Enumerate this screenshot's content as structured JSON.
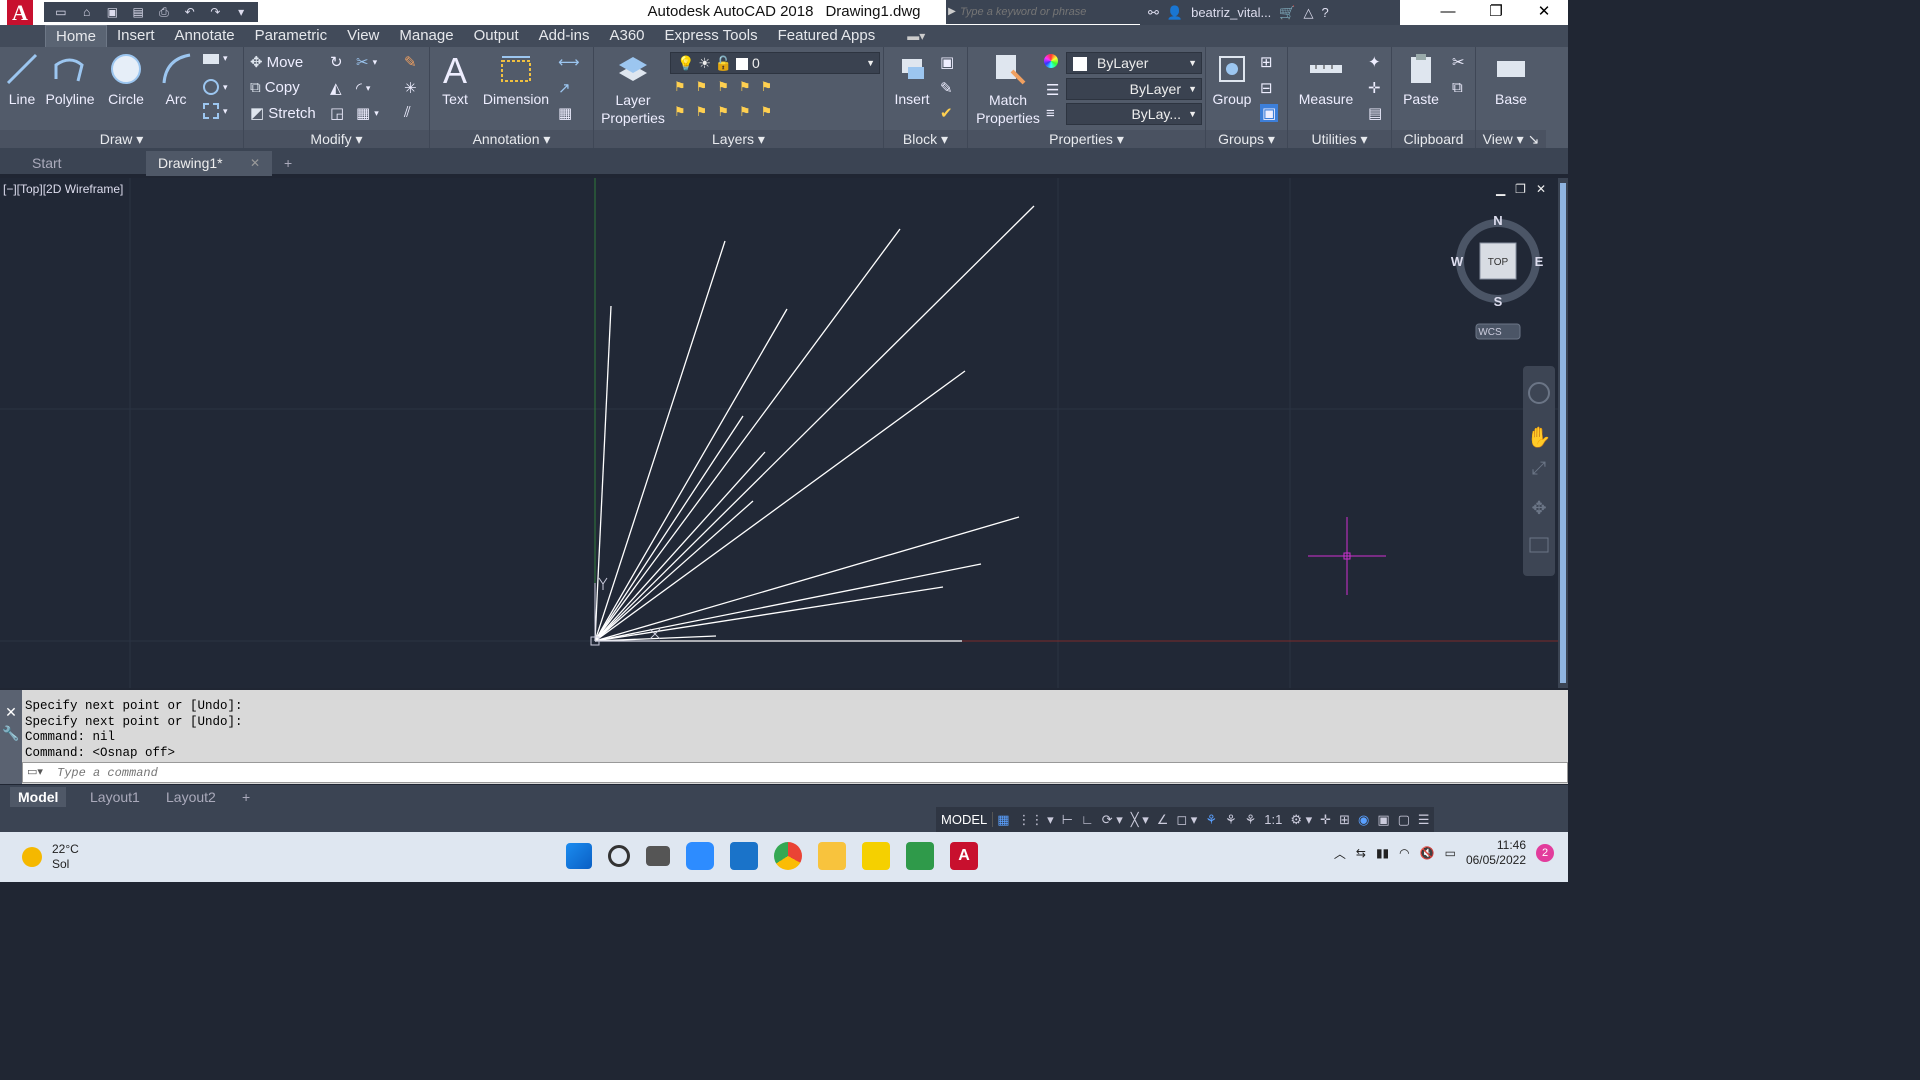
{
  "window": {
    "app": "Autodesk AutoCAD 2018",
    "doc": "Drawing1.dwg",
    "search_placeholder": "Type a keyword or phrase",
    "user": "beatriz_vital..."
  },
  "tabs": [
    "Home",
    "Insert",
    "Annotate",
    "Parametric",
    "View",
    "Manage",
    "Output",
    "Add-ins",
    "A360",
    "Express Tools",
    "Featured Apps"
  ],
  "ribbon": {
    "draw": {
      "title": "Draw",
      "line": "Line",
      "polyline": "Polyline",
      "circle": "Circle",
      "arc": "Arc"
    },
    "modify": {
      "title": "Modify",
      "move": "Move",
      "copy": "Copy",
      "stretch": "Stretch"
    },
    "annotation": {
      "title": "Annotation",
      "text": "Text",
      "dimension": "Dimension"
    },
    "layers": {
      "title": "Layers",
      "layer_properties": "Layer Properties",
      "current_layer": "0"
    },
    "block": {
      "title": "Block",
      "insert": "Insert"
    },
    "properties": {
      "title": "Properties",
      "match": "Match Properties",
      "color": "ByLayer",
      "linetype": "ByLayer",
      "lineweight": "ByLay..."
    },
    "groups": {
      "title": "Groups",
      "group": "Group"
    },
    "utilities": {
      "title": "Utilities",
      "measure": "Measure"
    },
    "clipboard": {
      "title": "Clipboard",
      "paste": "Paste"
    },
    "view": {
      "title": "View",
      "base": "Base"
    }
  },
  "doc_tabs": {
    "start": "Start",
    "drawing": "Drawing1*"
  },
  "viewport": {
    "label": "[−][Top][2D Wireframe]",
    "viewcube": {
      "top": "TOP",
      "n": "N",
      "s": "S",
      "e": "E",
      "w": "W",
      "wcs": "WCS"
    }
  },
  "command": {
    "lines": [
      "Specify next point or [Undo]:",
      "Specify next point or [Undo]:",
      "Command: nil",
      "Command:  <Osnap off>"
    ],
    "placeholder": "Type a command"
  },
  "layout_tabs": [
    "Model",
    "Layout1",
    "Layout2"
  ],
  "status": {
    "model": "MODEL",
    "scale": "1:1"
  },
  "taskbar": {
    "temp": "22°C",
    "weather": "Sol",
    "time": "11:46",
    "date": "06/05/2022",
    "notifications": "2"
  }
}
